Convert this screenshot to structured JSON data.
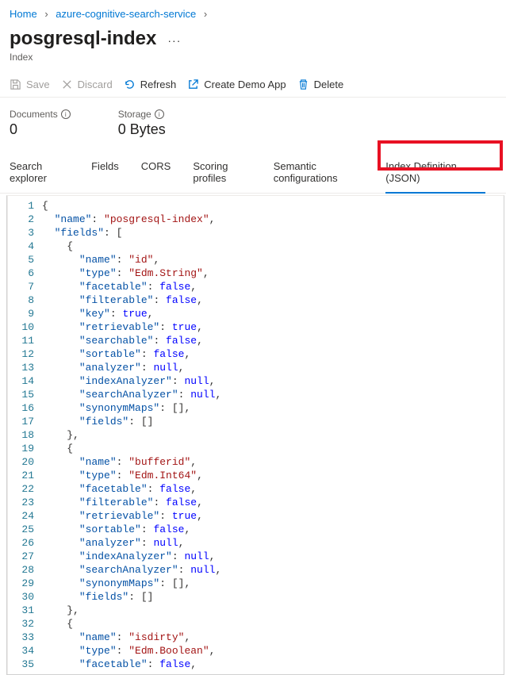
{
  "breadcrumb": {
    "home": "Home",
    "service": "azure-cognitive-search-service"
  },
  "title": "posgresql-index",
  "subtitle": "Index",
  "toolbar": {
    "save": "Save",
    "discard": "Discard",
    "refresh": "Refresh",
    "createDemo": "Create Demo App",
    "delete": "Delete"
  },
  "stats": {
    "docsLabel": "Documents",
    "docsValue": "0",
    "storageLabel": "Storage",
    "storageValue": "0 Bytes"
  },
  "tabs": {
    "search": "Search explorer",
    "fields": "Fields",
    "cors": "CORS",
    "scoring": "Scoring profiles",
    "semantic": "Semantic configurations",
    "json": "Index Definition (JSON)"
  },
  "code": {
    "lines": [
      "{",
      "  \"name\": \"posgresql-index\",",
      "  \"fields\": [",
      "    {",
      "      \"name\": \"id\",",
      "      \"type\": \"Edm.String\",",
      "      \"facetable\": false,",
      "      \"filterable\": false,",
      "      \"key\": true,",
      "      \"retrievable\": true,",
      "      \"searchable\": false,",
      "      \"sortable\": false,",
      "      \"analyzer\": null,",
      "      \"indexAnalyzer\": null,",
      "      \"searchAnalyzer\": null,",
      "      \"synonymMaps\": [],",
      "      \"fields\": []",
      "    },",
      "    {",
      "      \"name\": \"bufferid\",",
      "      \"type\": \"Edm.Int64\",",
      "      \"facetable\": false,",
      "      \"filterable\": false,",
      "      \"retrievable\": true,",
      "      \"sortable\": false,",
      "      \"analyzer\": null,",
      "      \"indexAnalyzer\": null,",
      "      \"searchAnalyzer\": null,",
      "      \"synonymMaps\": [],",
      "      \"fields\": []",
      "    },",
      "    {",
      "      \"name\": \"isdirty\",",
      "      \"type\": \"Edm.Boolean\",",
      "      \"facetable\": false,"
    ]
  }
}
